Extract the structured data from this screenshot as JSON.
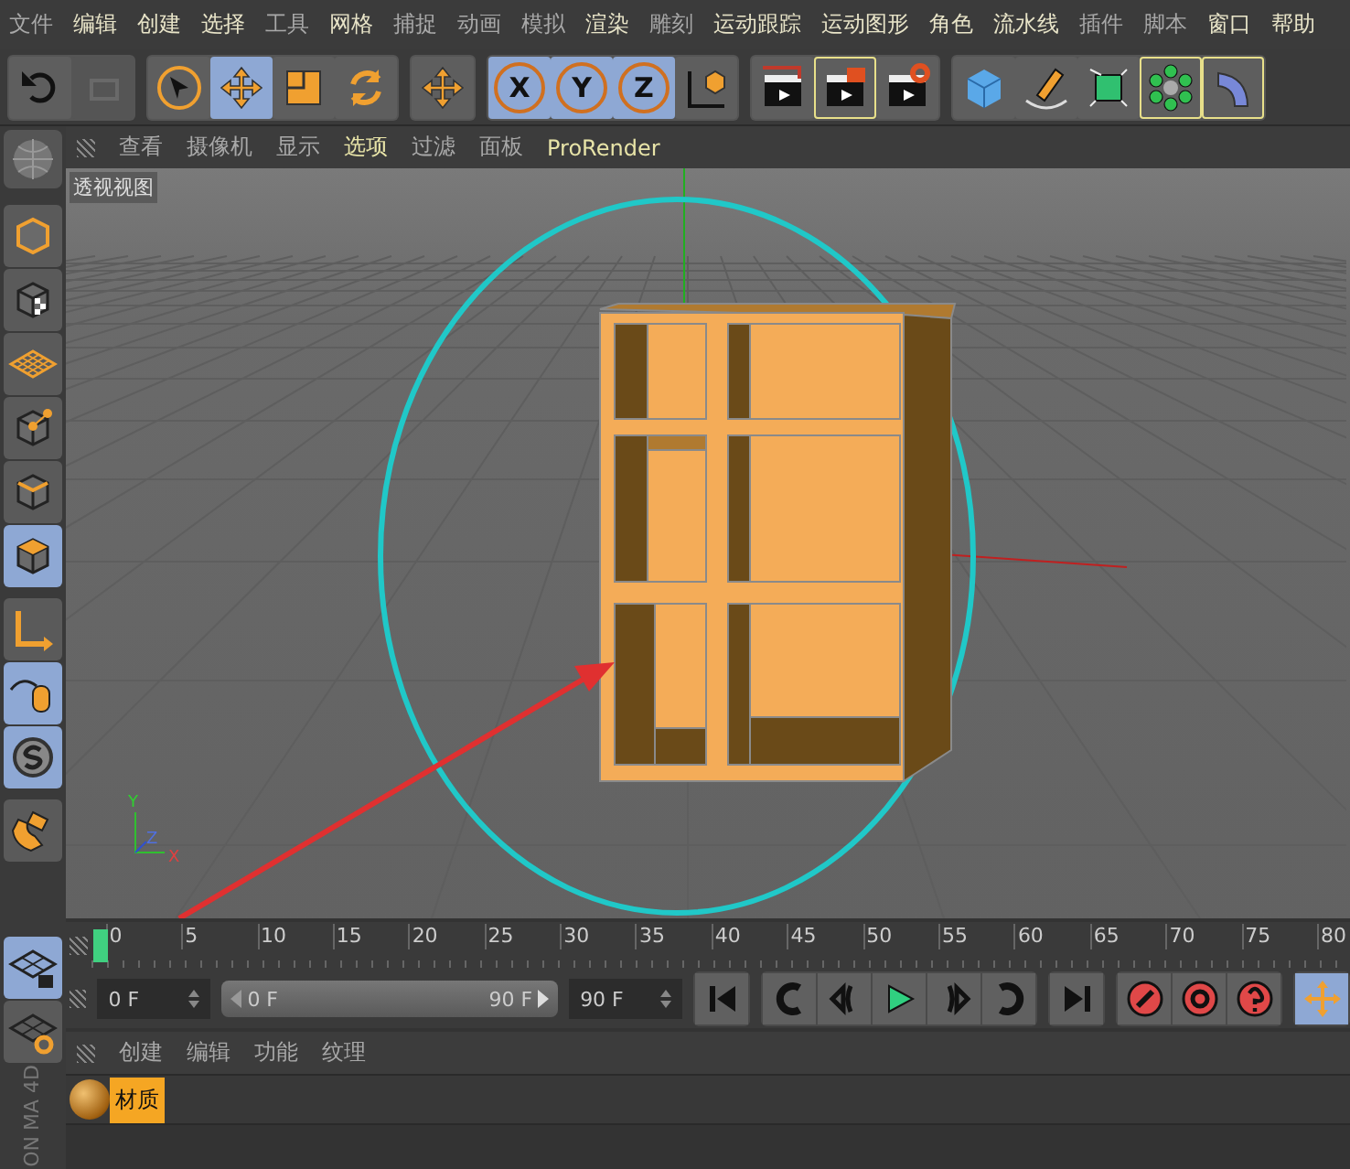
{
  "menu": [
    {
      "label": "文件",
      "highlighted": false
    },
    {
      "label": "编辑",
      "highlighted": true
    },
    {
      "label": "创建",
      "highlighted": true
    },
    {
      "label": "选择",
      "highlighted": true
    },
    {
      "label": "工具",
      "highlighted": false
    },
    {
      "label": "网格",
      "highlighted": true
    },
    {
      "label": "捕捉",
      "highlighted": false
    },
    {
      "label": "动画",
      "highlighted": false
    },
    {
      "label": "模拟",
      "highlighted": false
    },
    {
      "label": "渲染",
      "highlighted": true
    },
    {
      "label": "雕刻",
      "highlighted": false
    },
    {
      "label": "运动跟踪",
      "highlighted": true
    },
    {
      "label": "运动图形",
      "highlighted": true
    },
    {
      "label": "角色",
      "highlighted": true
    },
    {
      "label": "流水线",
      "highlighted": true
    },
    {
      "label": "插件",
      "highlighted": false
    },
    {
      "label": "脚本",
      "highlighted": false
    },
    {
      "label": "窗口",
      "highlighted": true
    },
    {
      "label": "帮助",
      "highlighted": true
    }
  ],
  "toolbar": [
    [
      {
        "selected": false,
        "outlined": false,
        "disabled": false
      },
      {
        "selected": false,
        "outlined": false,
        "disabled": true
      }
    ],
    [
      {
        "selected": false,
        "outlined": false,
        "disabled": false
      },
      {
        "selected": true,
        "outlined": false,
        "disabled": false
      },
      {
        "selected": false,
        "outlined": false,
        "disabled": false
      },
      {
        "selected": false,
        "outlined": false,
        "disabled": false
      }
    ],
    [
      {
        "selected": false,
        "outlined": false,
        "disabled": false
      }
    ],
    [
      {
        "selected": true,
        "outlined": false,
        "disabled": false,
        "letter": "X"
      },
      {
        "selected": true,
        "outlined": false,
        "disabled": false,
        "letter": "Y"
      },
      {
        "selected": true,
        "outlined": false,
        "disabled": false,
        "letter": "Z"
      },
      {
        "selected": false,
        "outlined": false,
        "disabled": false
      }
    ],
    [
      {
        "selected": false,
        "outlined": false,
        "disabled": false
      },
      {
        "selected": false,
        "outlined": true,
        "disabled": false
      },
      {
        "selected": false,
        "outlined": false,
        "disabled": false
      }
    ],
    [
      {
        "selected": false,
        "outlined": false,
        "disabled": false
      },
      {
        "selected": false,
        "outlined": false,
        "disabled": false
      },
      {
        "selected": false,
        "outlined": false,
        "disabled": false
      },
      {
        "selected": false,
        "outlined": true,
        "disabled": false
      },
      {
        "selected": false,
        "outlined": true,
        "disabled": false
      }
    ]
  ],
  "side_toolbar": [
    {
      "selected": false
    },
    {
      "selected": false
    },
    {
      "selected": false
    },
    {
      "selected": false
    },
    {
      "selected": false
    },
    {
      "selected": true
    },
    {
      "selected": false
    },
    {
      "selected": true
    },
    {
      "selected": true
    },
    {
      "selected": false
    }
  ],
  "side_toolbar_bottom": [
    {
      "selected": true
    },
    {
      "selected": false
    }
  ],
  "brand_text": [
    "MA 4D",
    "ON"
  ],
  "viewport": {
    "menu": [
      {
        "label": "查看",
        "highlighted": false
      },
      {
        "label": "摄像机",
        "highlighted": false
      },
      {
        "label": "显示",
        "highlighted": false
      },
      {
        "label": "选项",
        "highlighted": true
      },
      {
        "label": "过滤",
        "highlighted": false
      },
      {
        "label": "面板",
        "highlighted": false
      },
      {
        "label": "ProRender",
        "highlighted": true
      }
    ],
    "camera_label": "透视视图",
    "axis_labels": [
      "Y",
      "Z",
      "X"
    ]
  },
  "timeline": {
    "ticks": [
      "0",
      "5",
      "10",
      "15",
      "20",
      "25",
      "30",
      "35",
      "40",
      "45",
      "50",
      "55",
      "60",
      "65",
      "70",
      "75",
      "80"
    ]
  },
  "controls": {
    "start_field": "0 F",
    "range_start": "0 F",
    "range_end": "90 F",
    "end_field": "90 F"
  },
  "material_manager": {
    "menu": [
      "创建",
      "编辑",
      "功能",
      "纹理"
    ],
    "materials": [
      {
        "name": "材质",
        "selected": true
      }
    ]
  }
}
